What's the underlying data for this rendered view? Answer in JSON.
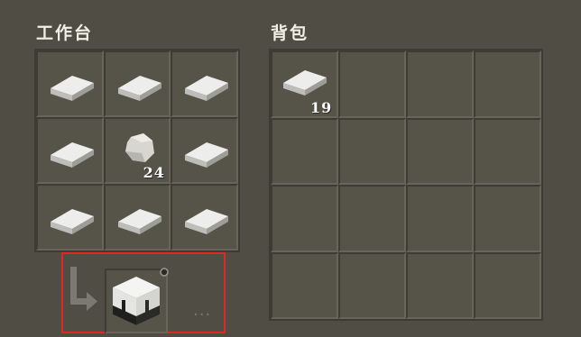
{
  "crafting": {
    "title": "工作台",
    "slots": [
      {
        "item": "iron-ingot-icon",
        "count": ""
      },
      {
        "item": "iron-ingot-icon",
        "count": ""
      },
      {
        "item": "iron-ingot-icon",
        "count": ""
      },
      {
        "item": "iron-ingot-icon",
        "count": ""
      },
      {
        "item": "stone-icon",
        "count": "24"
      },
      {
        "item": "iron-ingot-icon",
        "count": ""
      },
      {
        "item": "iron-ingot-icon",
        "count": ""
      },
      {
        "item": "iron-ingot-icon",
        "count": ""
      },
      {
        "item": "iron-ingot-icon",
        "count": ""
      }
    ],
    "arrow_icon": "arrow-down-right-icon",
    "result_item": "furnace-block-icon",
    "more_text": "..."
  },
  "inventory": {
    "title": "背包",
    "first_slot_item": "iron-ingot-icon",
    "first_slot_count": "19"
  },
  "colors": {
    "highlight_border": "#e0262b",
    "background": "#4f4d44"
  }
}
